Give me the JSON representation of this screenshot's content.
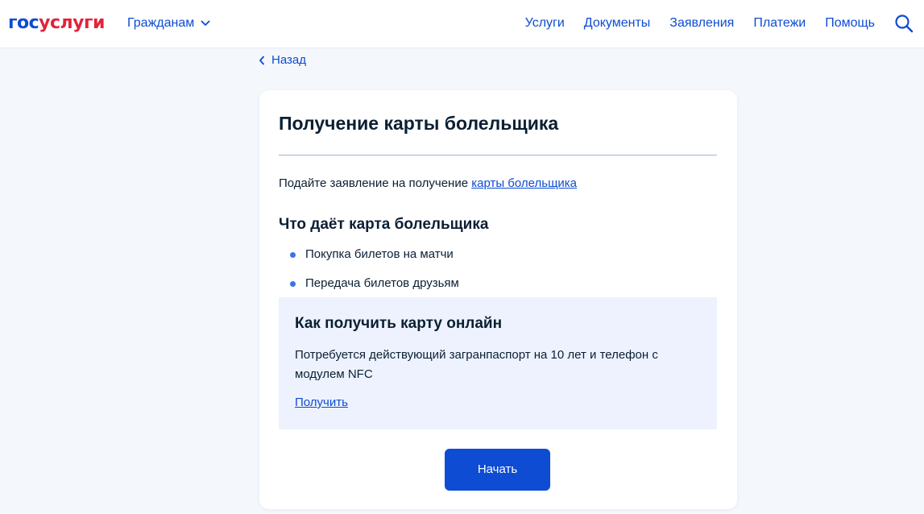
{
  "header": {
    "logo_part1": "гос",
    "logo_part2": "услуги",
    "citizens_label": "Гражданам",
    "nav": [
      "Услуги",
      "Документы",
      "Заявления",
      "Платежи",
      "Помощь"
    ]
  },
  "back_label": "Назад",
  "card": {
    "title": "Получение карты болельщика",
    "intro_text": "Подайте заявление на получение ",
    "intro_link": "карты болельщика",
    "subtitle": "Что даёт карта болельщика",
    "bullets": [
      "Покупка билетов на матчи",
      "Передача билетов друзьям"
    ],
    "info": {
      "title": "Как получить карту онлайн",
      "text": "Потребуется действующий загранпаспорт на 10 лет и телефон с модулем NFC",
      "link": "Получить"
    },
    "start_label": "Начать"
  },
  "colors": {
    "accent": "#0d4cd3",
    "logo_red": "#e3233b",
    "info_bg": "#edf2fe",
    "page_bg": "#f4f7fc"
  }
}
